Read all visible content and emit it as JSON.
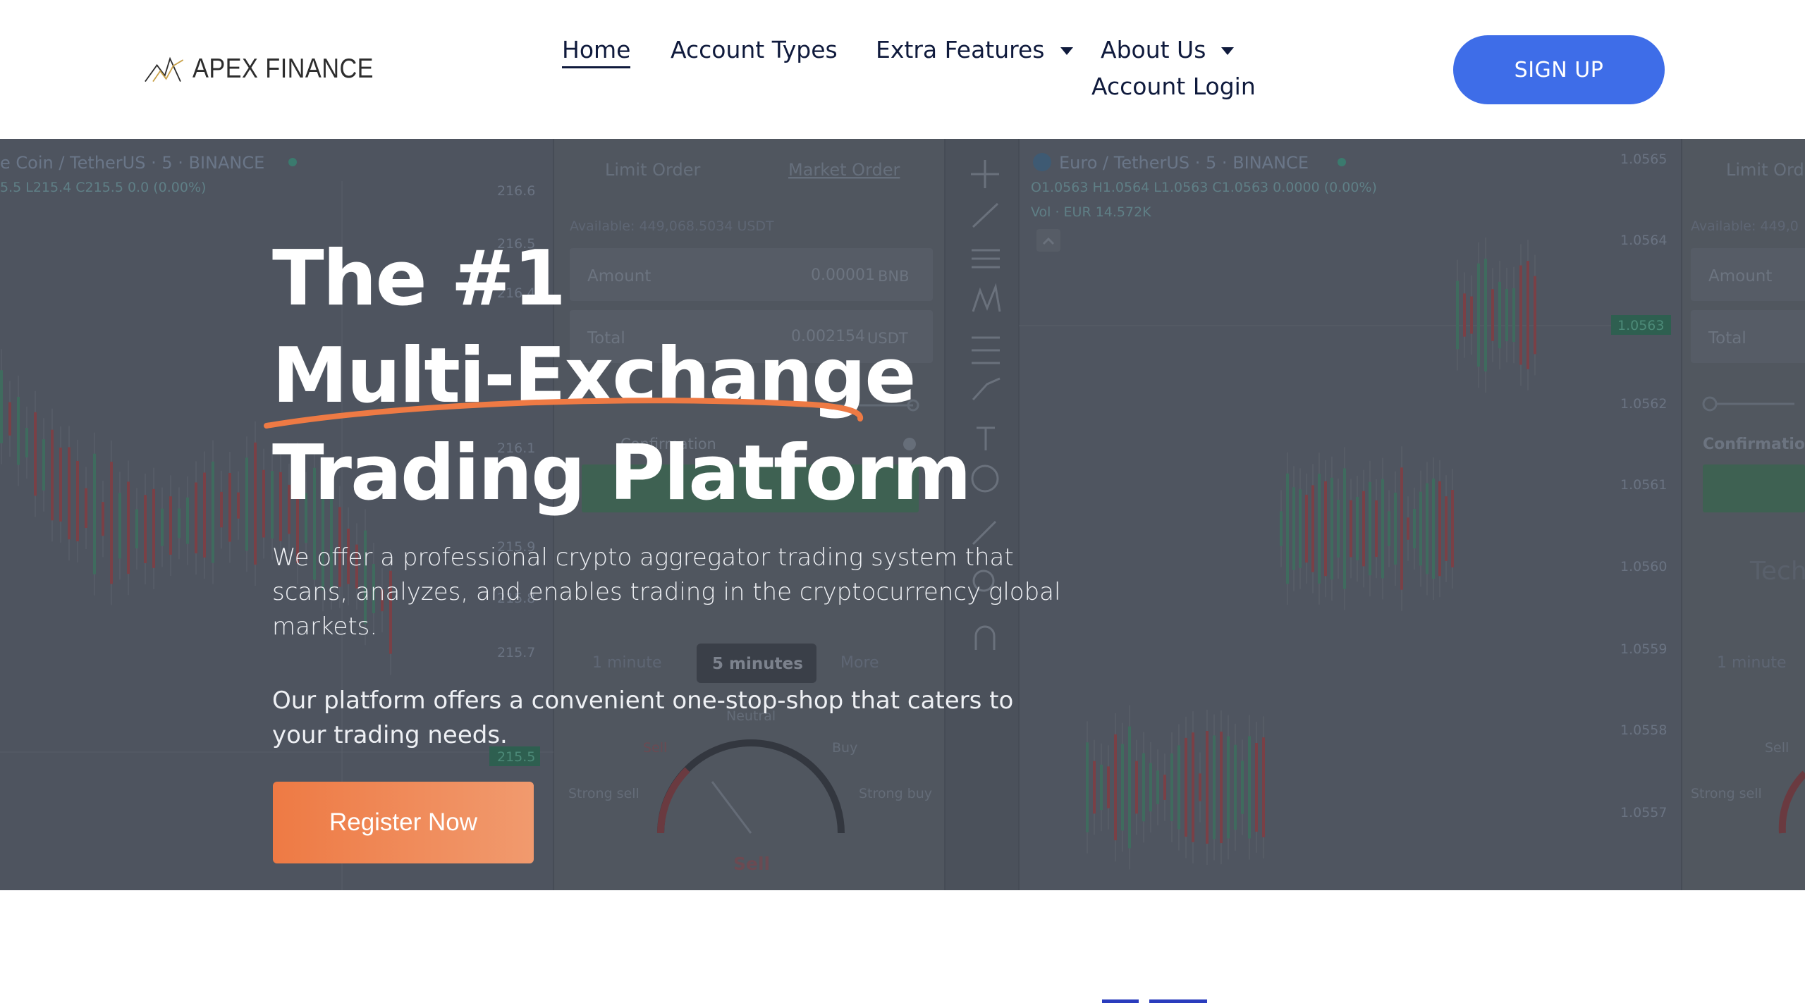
{
  "header": {
    "logo_text": "APEX FINANCE",
    "nav": {
      "home": "Home",
      "account_types": "Account Types",
      "extra_features": "Extra Features",
      "about_us": "About Us",
      "account_login": "Account Login"
    },
    "signup_label": "SIGN UP"
  },
  "hero": {
    "title_line1": "The #1",
    "title_line2": "Multi-Exchange",
    "title_line3": "Trading Platform",
    "description": "We offer a professional crypto aggregator trading system that scans, analyzes, and enables trading in the cryptocurrency global markets.",
    "description2": "Our platform offers a convenient one-stop-shop that caters to your trading needs.",
    "register_label": "Register Now"
  },
  "background": {
    "left_pair": "e Coin / TetherUS · 5 · BINANCE",
    "left_ohlc": "5.5  L215.4  C215.5  0.0 (0.00%)",
    "tab_limit": "Limit Order",
    "tab_market": "Market Order",
    "available": "Available: 449,068.5034 USDT",
    "amount_label": "Amount",
    "amount_value": "0.00001",
    "amount_unit": "BNB",
    "total_label": "Total",
    "total_value": "0.002154",
    "total_unit": "USDT",
    "confirmation": "Confirmation",
    "interval_1m": "1 minute",
    "interval_5m": "5 minutes",
    "interval_more": "More",
    "gauge_neutral": "Neutral",
    "gauge_sell": "Sell",
    "gauge_buy": "Buy",
    "gauge_strong_sell": "Strong sell",
    "gauge_strong_buy": "Strong buy",
    "gauge_result": "Sell",
    "left_price_scale": [
      "216.6",
      "216.5",
      "216.4",
      "216.1",
      "215.9",
      "215.8",
      "215.7",
      "215.5"
    ],
    "right_pair": "Euro / TetherUS · 5 · BINANCE",
    "right_ohlc": "O1.0563  H1.0564  L1.0563  C1.0563  0.0000 (0.00%)",
    "right_vol": "Vol · EUR  14.572K",
    "right_price_scale": [
      "1.0565",
      "1.0564",
      "1.0563",
      "1.0562",
      "1.0561",
      "1.0560",
      "1.0559",
      "1.0558",
      "1.0557"
    ],
    "right_tab_limit": "Limit Orde",
    "right_available": "Available: 449,0",
    "right_amount_label": "Amount",
    "right_total_label": "Total",
    "right_confirmation": "Confirmation",
    "right_tech": "Tech",
    "right_interval": "1 minute",
    "right_gauge_sell": "Sell",
    "right_gauge_strong_sell": "Strong sell"
  },
  "colors": {
    "signup_bg": "#3e6de8",
    "register_bg": "#ee7a44",
    "nav_text": "#0f1a3c",
    "swoosh": "#ee7a44"
  }
}
